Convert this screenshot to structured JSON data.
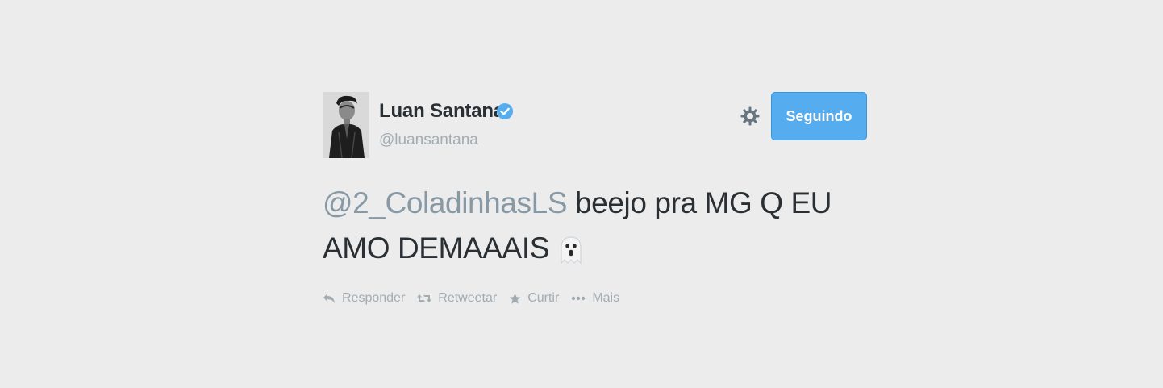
{
  "tweet": {
    "display_name": "Luan Santana",
    "verified": true,
    "screen_name": "@luansantana",
    "follow_button_label": "Seguindo",
    "text_mention": "@2_ColadinhasLS",
    "text_body_line1": " beejo pra MG Q EU",
    "text_body_line2": "AMO DEMAAAIS",
    "emoji": "ghost-emoji"
  },
  "actions": [
    {
      "icon": "reply-icon",
      "label": "Responder"
    },
    {
      "icon": "retweet-icon",
      "label": "Retweetar"
    },
    {
      "icon": "star-icon",
      "label": "Curtir"
    },
    {
      "icon": "more-dots-icon",
      "label": "Mais"
    }
  ],
  "colors": {
    "background": "#ececec",
    "accent": "#55acee",
    "muted": "#a2acb3",
    "text": "#292f33"
  }
}
